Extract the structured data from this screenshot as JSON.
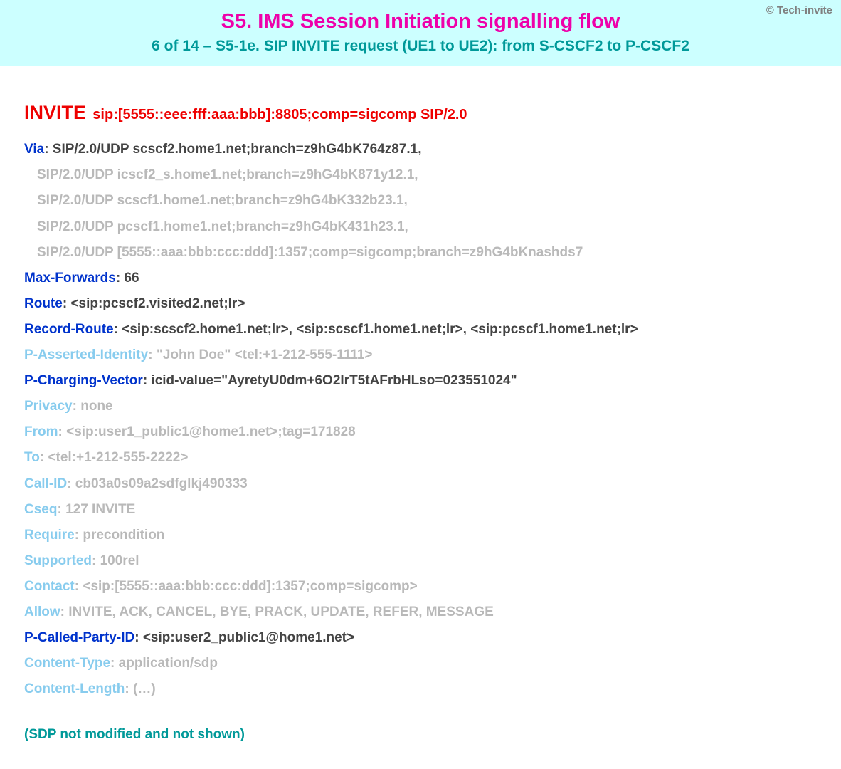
{
  "attribution": "© Tech-invite",
  "title": "S5. IMS Session Initiation signalling flow",
  "subtitle": "6 of 14 – S5-1e. SIP INVITE request (UE1 to UE2): from S-CSCF2 to P-CSCF2",
  "request": {
    "method": "INVITE",
    "uri": "sip:[5555::eee:fff:aaa:bbb]:8805;comp=sigcomp SIP/2.0"
  },
  "via": {
    "label": "Via",
    "first": "SIP/2.0/UDP scscf2.home1.net;branch=z9hG4bK764z87.1,",
    "rest": [
      "SIP/2.0/UDP icscf2_s.home1.net;branch=z9hG4bK871y12.1,",
      "SIP/2.0/UDP scscf1.home1.net;branch=z9hG4bK332b23.1,",
      "SIP/2.0/UDP pcscf1.home1.net;branch=z9hG4bK431h23.1,",
      "SIP/2.0/UDP [5555::aaa:bbb:ccc:ddd]:1357;comp=sigcomp;branch=z9hG4bKnashds7"
    ]
  },
  "headers": {
    "max_forwards": {
      "label": "Max-Forwards",
      "value": "66",
      "emph": "blue"
    },
    "route": {
      "label": "Route",
      "value": "<sip:pcscf2.visited2.net;lr>",
      "emph": "blue"
    },
    "record_route": {
      "label": "Record-Route",
      "value": "<sip:scscf2.home1.net;lr>, <sip:scscf1.home1.net;lr>, <sip:pcscf1.home1.net;lr>",
      "emph": "blue"
    },
    "p_asserted": {
      "label": "P-Asserted-Identity",
      "value": "\"John Doe\" <tel:+1-212-555-1111>",
      "emph": "sky"
    },
    "p_charging": {
      "label": "P-Charging-Vector",
      "value": "icid-value=\"AyretyU0dm+6O2IrT5tAFrbHLso=023551024\"",
      "emph": "blue"
    },
    "privacy": {
      "label": "Privacy",
      "value": "none",
      "emph": "sky"
    },
    "from": {
      "label": "From",
      "value": "<sip:user1_public1@home1.net>;tag=171828",
      "emph": "sky"
    },
    "to": {
      "label": "To",
      "value": "<tel:+1-212-555-2222>",
      "emph": "sky"
    },
    "call_id": {
      "label": "Call-ID",
      "value": "cb03a0s09a2sdfglkj490333",
      "emph": "sky"
    },
    "cseq": {
      "label": "Cseq",
      "value": "127 INVITE",
      "emph": "sky"
    },
    "require": {
      "label": "Require",
      "value": "precondition",
      "emph": "sky"
    },
    "supported": {
      "label": "Supported",
      "value": "100rel",
      "emph": "sky"
    },
    "contact": {
      "label": "Contact",
      "value": "<sip:[5555::aaa:bbb:ccc:ddd]:1357;comp=sigcomp>",
      "emph": "sky"
    },
    "allow": {
      "label": "Allow",
      "value": "INVITE, ACK, CANCEL, BYE, PRACK, UPDATE, REFER, MESSAGE",
      "emph": "sky"
    },
    "p_called": {
      "label": "P-Called-Party-ID",
      "value": "<sip:user2_public1@home1.net>",
      "emph": "blue"
    },
    "content_type": {
      "label": "Content-Type",
      "value": "application/sdp",
      "emph": "sky"
    },
    "content_length": {
      "label": "Content-Length",
      "value": "(…)",
      "emph": "sky"
    }
  },
  "note": "(SDP not modified and not shown)"
}
